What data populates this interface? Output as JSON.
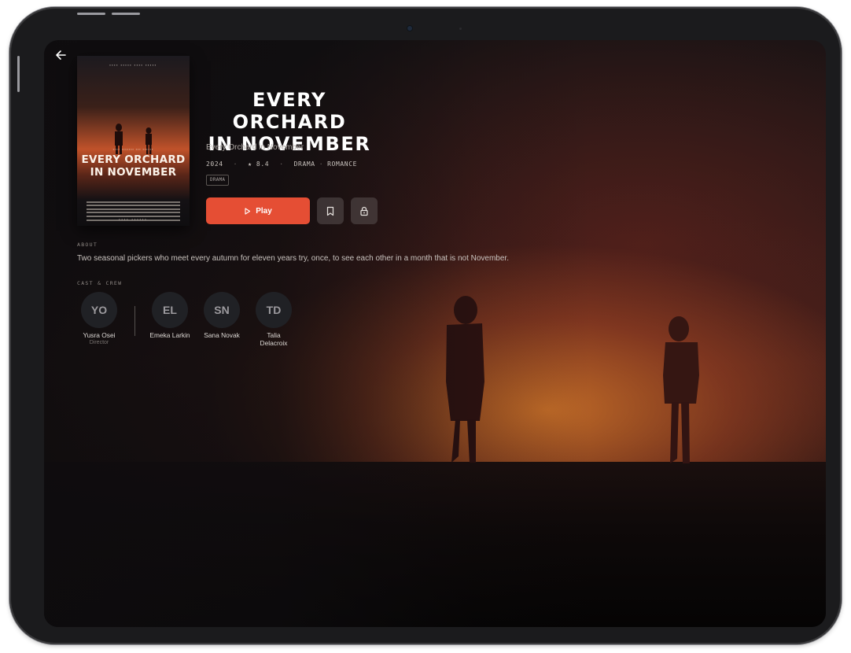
{
  "movie": {
    "title": "EVERY ORCHARD IN NOVEMBER",
    "title_line1": "EVERY ORCHARD",
    "title_line2": "IN NOVEMBER",
    "subtitle": "Every Orchard in November",
    "year": "2024",
    "rating": "★ 8.4",
    "genres": [
      "DRAMA",
      "ROMANCE"
    ],
    "tag": "DRAMA"
  },
  "actions": {
    "play_label": "Play",
    "bookmark_icon": "bookmark-icon",
    "lock_icon": "lock-icon",
    "back_icon": "arrow-left-icon"
  },
  "poster": {
    "title_line1": "EVERY ORCHARD",
    "title_line2": "IN NOVEMBER"
  },
  "about": {
    "label": "ABOUT",
    "text": "Two seasonal pickers who meet every autumn for eleven years try, once, to see each other in a month that is not November."
  },
  "cast": {
    "label": "CAST & CREW",
    "people": [
      {
        "initials": "YO",
        "name": "Yusra Osei",
        "role": "Director"
      },
      {
        "initials": "EL",
        "name": "Emeka Larkin",
        "role": ""
      },
      {
        "initials": "SN",
        "name": "Sana Novak",
        "role": ""
      },
      {
        "initials": "TD",
        "name": "Talia Delacroix",
        "role": ""
      }
    ]
  },
  "colors": {
    "accent": "#e54e34",
    "background": "#141214",
    "text": "#ffffff"
  }
}
